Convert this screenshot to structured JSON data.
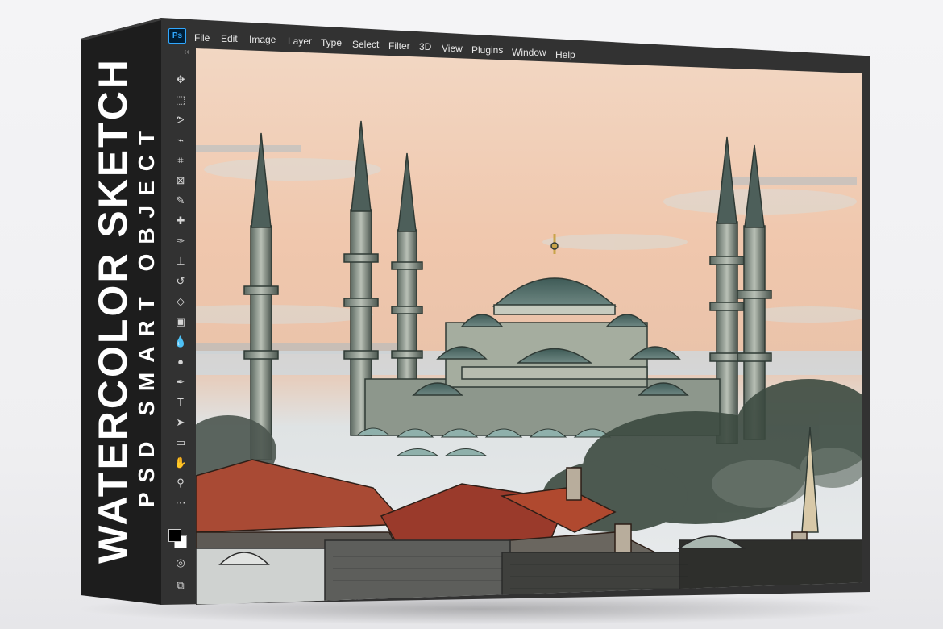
{
  "box": {
    "spine_title": "WATERCOLOR SKETCH",
    "spine_subtitle": "PSD SMART OBJECT"
  },
  "app": {
    "logo": "Ps",
    "menu": [
      "File",
      "Edit",
      "Image",
      "Layer",
      "Type",
      "Select",
      "Filter",
      "3D",
      "View",
      "Plugins",
      "Window",
      "Help"
    ],
    "toolbar_collapse": "‹‹",
    "tools": [
      {
        "name": "move-tool-icon",
        "glyph": "✥"
      },
      {
        "name": "marquee-tool-icon",
        "glyph": "⬚"
      },
      {
        "name": "lasso-tool-icon",
        "glyph": "ᕗ"
      },
      {
        "name": "quick-select-tool-icon",
        "glyph": "⌁"
      },
      {
        "name": "crop-tool-icon",
        "glyph": "⌗"
      },
      {
        "name": "frame-tool-icon",
        "glyph": "⊠"
      },
      {
        "name": "eyedropper-tool-icon",
        "glyph": "✎"
      },
      {
        "name": "healing-brush-tool-icon",
        "glyph": "✚"
      },
      {
        "name": "brush-tool-icon",
        "glyph": "✑"
      },
      {
        "name": "stamp-tool-icon",
        "glyph": "⊥"
      },
      {
        "name": "history-brush-tool-icon",
        "glyph": "↺"
      },
      {
        "name": "eraser-tool-icon",
        "glyph": "◇"
      },
      {
        "name": "gradient-tool-icon",
        "glyph": "▣"
      },
      {
        "name": "blur-tool-icon",
        "glyph": "💧"
      },
      {
        "name": "dodge-tool-icon",
        "glyph": "●"
      },
      {
        "name": "pen-tool-icon",
        "glyph": "✒"
      },
      {
        "name": "type-tool-icon",
        "glyph": "T"
      },
      {
        "name": "path-select-tool-icon",
        "glyph": "➤"
      },
      {
        "name": "rectangle-tool-icon",
        "glyph": "▭"
      },
      {
        "name": "hand-tool-icon",
        "glyph": "✋"
      },
      {
        "name": "zoom-tool-icon",
        "glyph": "⚲"
      },
      {
        "name": "more-tools-icon",
        "glyph": "⋯"
      }
    ],
    "bottom_tools": [
      {
        "name": "quick-mask-icon",
        "glyph": "◎"
      },
      {
        "name": "screen-mode-icon",
        "glyph": "⧉"
      }
    ],
    "colors": {
      "foreground": "#000000",
      "background": "#ffffff",
      "ps_blue": "#31a8ff"
    }
  }
}
